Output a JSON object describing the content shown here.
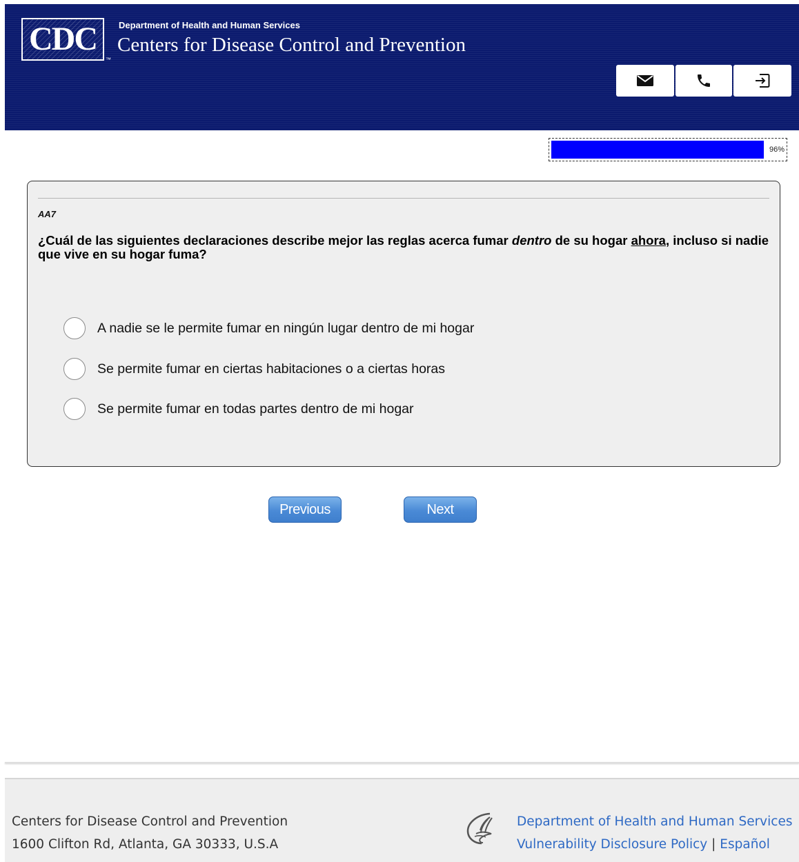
{
  "header": {
    "logo_text": "CDC",
    "logo_tm": "™",
    "dept_small": "Department of Health and Human Services",
    "dept_large": "Centers for Disease Control and Prevention",
    "buttons": [
      {
        "icon": "envelope-icon"
      },
      {
        "icon": "phone-icon"
      },
      {
        "icon": "exit-icon"
      }
    ],
    "background_color": "#0b1a6e"
  },
  "progress": {
    "percent": 96,
    "label": "96%",
    "fill_color": "#0000ff"
  },
  "question": {
    "id": "AA7",
    "text_part1": "¿Cuál de las siguientes declaraciones describe mejor las reglas acerca fumar ",
    "text_emphasis": "dentro",
    "text_part2": " de su hogar ",
    "text_underline": "ahora",
    "text_part3": ", incluso si nadie que vive en su hogar fuma?",
    "options": [
      {
        "label": "A nadie se le permite fumar en ningún lugar dentro de mi hogar",
        "selected": false
      },
      {
        "label": "Se permite fumar en ciertas habitaciones o a ciertas horas",
        "selected": false
      },
      {
        "label": "Se permite fumar en todas partes dentro de mi hogar",
        "selected": false
      }
    ]
  },
  "nav": {
    "previous_label": "Previous",
    "next_label": "Next"
  },
  "footer": {
    "org_name": "Centers for Disease Control and Prevention",
    "address": "1600 Clifton Rd, Atlanta, GA 30333, U.S.A",
    "hhs_link": "Department of Health and Human Services",
    "vdp_link": "Vulnerability Disclosure Policy",
    "separator": "|",
    "espanol_link": "Español",
    "link_color": "#2e69c4"
  }
}
